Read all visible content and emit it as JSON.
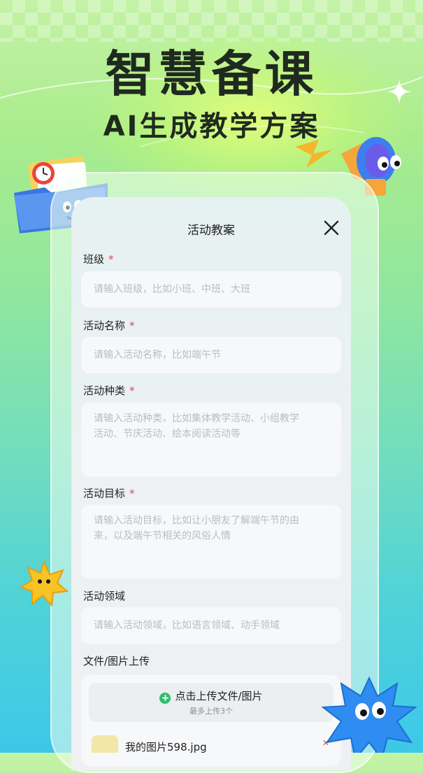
{
  "hero": {
    "title": "智慧备课",
    "subtitle": "AI生成教学方案"
  },
  "dialog": {
    "title": "活动教案",
    "close_icon": "close-icon"
  },
  "form": {
    "class": {
      "label": "班级",
      "required": "*",
      "placeholder": "请输入班级，比如小班、中班、大班"
    },
    "activity_name": {
      "label": "活动名称",
      "required": "*",
      "placeholder": "请输入活动名称，比如端午节"
    },
    "activity_type": {
      "label": "活动种类",
      "required": "*",
      "placeholder_line1": "请输入活动种类，比如集体教学活动、小组教学",
      "placeholder_line2": "活动、节庆活动、绘本阅读活动等"
    },
    "activity_goal": {
      "label": "活动目标",
      "required": "*",
      "placeholder_line1": "请输入活动目标，比如让小朋友了解端午节的由",
      "placeholder_line2": "来，以及端午节相关的风俗人情"
    },
    "activity_area": {
      "label": "活动领域",
      "placeholder": "请输入活动领域，比如语言领域、动手领域"
    },
    "upload": {
      "label": "文件/图片上传",
      "button_label": "点击上传文件/图片",
      "hint": "最多上传3个",
      "files": [
        {
          "name": "我的图片598.jpg"
        }
      ]
    }
  },
  "colors": {
    "required": "#e04848",
    "upload_plus": "#2cbf6b",
    "placeholder": "#b9bcc2"
  },
  "icons": [
    "sparkle-icon",
    "close-icon",
    "plus-circle-icon",
    "folder-mascot-icon",
    "megaphone-mascot-icon",
    "star-mascot-icon",
    "spiky-mascot-icon"
  ]
}
